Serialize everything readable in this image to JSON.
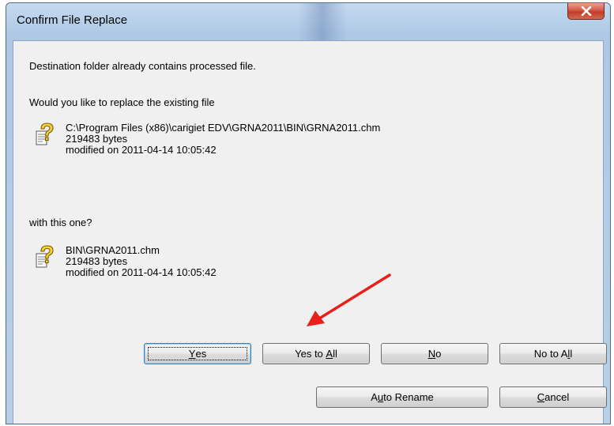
{
  "window": {
    "title": "Confirm File Replace",
    "close_label": "close"
  },
  "dialog": {
    "message": "Destination folder already contains processed file.",
    "question": "Would you like to replace the existing file",
    "existing_file": {
      "path": "C:\\Program Files (x86)\\carigiet EDV\\GRNA2011\\BIN\\GRNA2011.chm",
      "size": "219483 bytes",
      "modified": "modified on 2011-04-14 10:05:42",
      "icon": "unknown-file-question-icon"
    },
    "with_label": "with this one?",
    "new_file": {
      "path": "BIN\\GRNA2011.chm",
      "size": "219483 bytes",
      "modified": "modified on 2011-04-14 10:05:42",
      "icon": "unknown-file-question-icon"
    }
  },
  "buttons": {
    "yes": {
      "pre": "",
      "key": "Y",
      "post": "es"
    },
    "yes_to_all": {
      "pre": "Yes to ",
      "key": "A",
      "post": "ll"
    },
    "no": {
      "pre": "",
      "key": "N",
      "post": "o"
    },
    "no_to_all": {
      "pre": "No to A",
      "key": "l",
      "post": "l"
    },
    "auto_rename": {
      "pre": "A",
      "key": "u",
      "post": "to Rename"
    },
    "cancel": {
      "pre": "",
      "key": "C",
      "post": "ancel"
    }
  },
  "colors": {
    "annotation_arrow": "#e8201a",
    "dialog_background": "#f0f0f0",
    "close_button": "#c94a36"
  }
}
